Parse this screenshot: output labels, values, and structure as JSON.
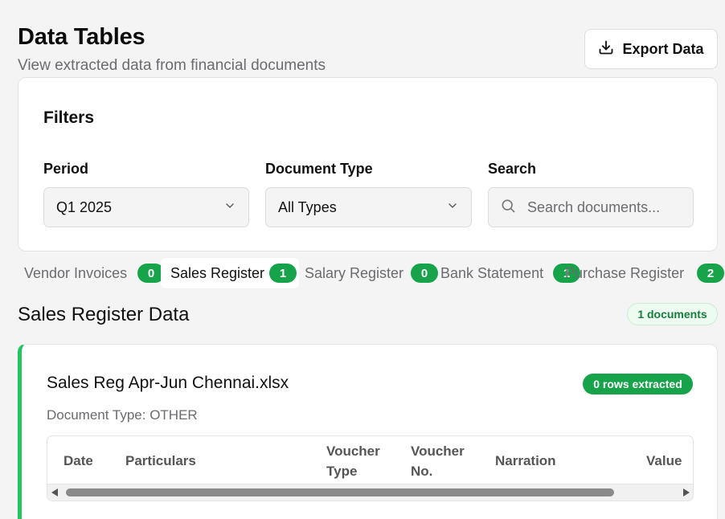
{
  "header": {
    "title": "Data Tables",
    "subtitle": "View extracted data from financial documents",
    "export_label": "Export Data"
  },
  "filters": {
    "title": "Filters",
    "period": {
      "label": "Period",
      "value": "Q1 2025"
    },
    "document_type": {
      "label": "Document Type",
      "value": "All Types"
    },
    "search": {
      "label": "Search",
      "placeholder": "Search documents..."
    }
  },
  "tabs": [
    {
      "label": "Vendor Invoices",
      "count": "0",
      "active": false
    },
    {
      "label": "Sales Register",
      "count": "1",
      "active": true
    },
    {
      "label": "Salary Register",
      "count": "0",
      "active": false
    },
    {
      "label": "Bank Statement",
      "count": "1",
      "active": false
    },
    {
      "label": "Purchase Register",
      "count": "2",
      "active": false
    }
  ],
  "section": {
    "title": "Sales Register Data",
    "count_label": "1 documents"
  },
  "document": {
    "name": "Sales Reg Apr-Jun Chennai.xlsx",
    "rows_label": "0 rows extracted",
    "type_label": "Document Type: OTHER",
    "columns": [
      "Date",
      "Particulars",
      "Voucher Type",
      "Voucher No.",
      "Narration",
      "Value"
    ]
  },
  "colors": {
    "accent_green": "#16a34a",
    "card_border_green": "#22c55e",
    "background": "#f4f4f5"
  },
  "icons": {
    "export": "download-icon",
    "dropdown": "chevron-down-icon",
    "search": "search-icon"
  }
}
